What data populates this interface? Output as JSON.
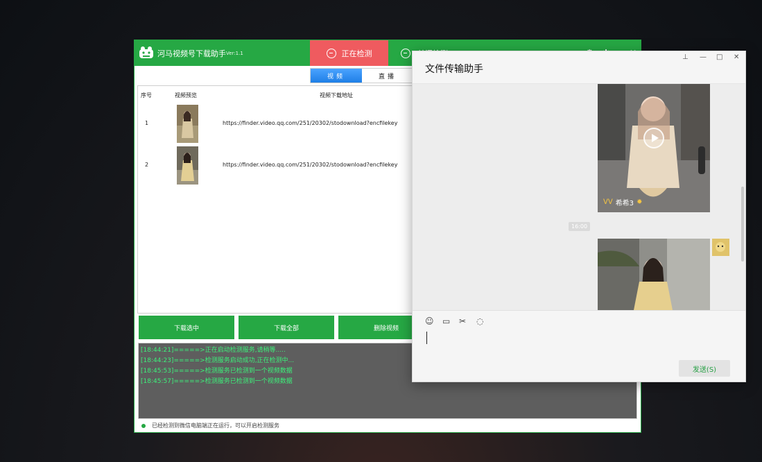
{
  "downloader": {
    "title": "河马视频号下载助手",
    "version": "Ver:1.1",
    "tabs": {
      "detecting": "正在检测",
      "stop": "关闭检测"
    },
    "segment": {
      "video": "视频",
      "live": "直播"
    },
    "table": {
      "headers": {
        "index": "序号",
        "preview": "视频预览",
        "url": "视频下载地址"
      },
      "rows": [
        {
          "index": "1",
          "url": "https://finder.video.qq.com/251/20302/stodownload?encfilekey"
        },
        {
          "index": "2",
          "url": "https://finder.video.qq.com/251/20302/stodownload?encfilekey"
        }
      ]
    },
    "buttons": {
      "download_selected": "下载选中",
      "download_all": "下载全部",
      "delete_video": "删除视频"
    },
    "log": [
      "[18:44:21]=====>正在启动检测服务,请稍等.....",
      "[18:44:23]=====>检测服务启动成功,正在检测中...",
      "[18:45:53]=====>检测服务已检测到一个视频数据",
      "[18:45:57]=====>检测服务已检测到一个视频数据"
    ],
    "status": "已经检测到微信电脑端正在运行，可以开启检测服务",
    "colors": {
      "brand": "#26a844",
      "active_tab": "#ef5b5f",
      "log_text": "#3df07a"
    }
  },
  "chat": {
    "title": "文件传输助手",
    "window_controls": {
      "pin": "⊥",
      "minimize": "—",
      "maximize": "□",
      "close": "✕"
    },
    "messages": [
      {
        "type": "video",
        "author": "希希3"
      },
      {
        "type": "time",
        "text": "16:00"
      },
      {
        "type": "video",
        "author": ""
      }
    ],
    "toolbar": [
      "emoji-icon",
      "folder-icon",
      "scissors-icon",
      "chat-history-icon"
    ],
    "send_label": "发送(S)"
  }
}
